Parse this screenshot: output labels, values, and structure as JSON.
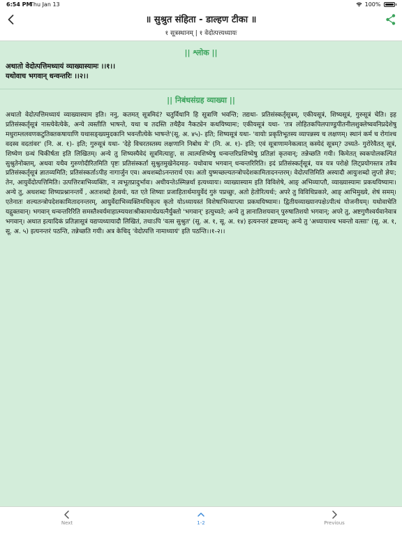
{
  "status_bar": {
    "time": "6:54 PM",
    "date": "Thu Jan 13",
    "battery": "100%"
  },
  "header": {
    "title": "॥ सुश्रुत संहिता - डाल्हण टीका ॥",
    "subtitle": "१ सूत्रस्थानम् | १ वेदोत्पत्त्यध्यायः"
  },
  "content": {
    "shloka_heading": "|| श्लोक ||",
    "shloka_lines": [
      "अथातो वेदोत्पत्तिमध्यायं व्याख्यास्यामः ।।१।।",
      "यथोवाच भगवान् धन्वन्तरिः ।।२।।"
    ],
    "vyakhya_heading": "|| निबंधसंग्रह व्याख्या ||",
    "vyakhya_text": "अथातो वेदोत्पत्तिमध्यायं व्याख्यास्याम इति। ननु, कतमत् सूत्रमिदं? चतुर्विधानि हि सूत्राणि भवन्ति; तद्यथा- प्रतिसंस्कर्तृसूत्रम्, एकीयसूत्रं, शिष्यसूत्रं, गुरुसूत्रं चेति। इह प्रतिसंस्कर्तृसूत्रं नास्त्येवेत्येके, अन्ये त्वस्तीति भाषन्ते, यथा च तदस्ति तथैहैव नैकट्येन कथयिष्यामः; एकीयसूत्रं यथा- 'तत्र लोहितकपिलपाण्डुपीतनीलशुक्लेष्ववनिप्रदेशेषु मधुराम्ललवणकटुतिक्तकषायाणि यथासङ्ख्यमुदकानि भवन्तीत्येके भाषन्ते'(सू. अ. ४५)- इति; शिष्यसूत्रं यथा- 'वायोः प्रकृतिभूतस्य व्यापन्नस्य च लक्षणम्। स्थानं कर्म च रोगांश्च वदस्व वदतांवर' (नि. अ. १)- इति; गुरुसूत्रं यथा- 'देहे विचरतस्तस्य लक्षणानि निबोध मे' (नि. अ. १)- इति; एवं सूत्राणामनेकत्वात् कस्येदं सूत्रम्? उच्यते- गुरोरेवैतत् सूत्रं, शिष्येण ग्रन्थं चिकीर्षता इति लिखितम्। अन्ये तु शिष्यस्यैवेदं सूत्रमित्याहुः, स त्वात्मशिष्येषु धन्वन्तरिप्रशिष्येषु प्रतिज्ञां कृतवान्; तन्नेच्छति गयी। किमेतत् स्वकपोलकल्पितं सुश्रुतेनोक्तम्, अथवा यथैव गुरुणोदीरितमिति पृष्टः प्रतिसंस्कर्ता सुश्रुतमुखेनेदमाह- यथोवाच भगवान् धन्वन्तरिरिति। इदं प्रतिसंस्कर्तृसूत्रं, यत्र यत्र परोक्षे लिट्प्रयोगस्तत्र तत्रैव प्रतिसंस्कर्तृसूत्रं ज्ञातव्यमिति; प्रतिसंस्कर्ताऽपीह नागार्जुन एव। अथशब्दोऽनन्तरार्थ एव। अतो युष्मच्छल्यतन्त्रोपदेशकामितादनन्तरम्। वेदोत्पत्तिमिति अस्यादौ आयुःशब्दो लुप्तो ज्ञेयः; तेन, आयुर्वेदोत्पत्तिमिति। उत्पत्तिरत्राभिव्यक्तिः, न त्वभूतप्रादुर्भावः। अधीयन्तेऽस्मिन्नर्था इत्यध्यायः। व्याख्यास्याम इति विविशेषे, आङ् अभिव्याप्तौ, व्याख्यास्यामः प्रकथयिष्यामः। अन्ये तु, अथशब्दः शिष्यप्रश्नानन्तर्ये , अतःशब्दो हेत्वर्थः, यत एते शिष्याः प्रजाहितार्थमायुर्वेदं गुरुं पप्रच्छुः, अतो हेतोरित्यर्थः; अपरे तु विविधिप्रकारे, आङ् आभिमुख्ये, शेषं समम्। एतेनातः शल्यतन्त्रोपदेशकामितादनन्तरम्, आयुर्वेदाभिव्यक्तिमधिकृत्य कृतो योऽध्यायस्तं विशेषाभिव्याप्त्या प्रकथयिष्यामः। द्वितीयव्याख्यानपक्षेऽपीत्थं योजनीयम्। यथोवाचेति यद्गुक्तवान्। भगवान् धन्वन्तरिरिति समस्तैश्वर्यमाहात्म्ययशःश्रीकामार्थप्रयत्नैर्युक्तो 'भगवान्' इत्युच्यते; अन्ये तु ज्ञानातिशयवान् पुरुषातिशयो भगवान्; अपरे तु, अष्टगुणैश्वर्यवानेवात्र भगवान्। अथात इत्यादिकं प्रतिज्ञासूत्रं यद्यप्यध्यायादौ लिखितं, तथाऽपि 'वत्स सुश्रुत' (सू. अ. १, सू. अ. १४) इत्यनन्तरं द्रष्टव्यम्; अन्ये तु 'अध्यायाश्च भवन्तो वत्साः' (सू. अ. १, सू. अ. ५) इत्यनन्तरं पठन्ति, तन्नेच्छति गयी। अत्र केचिद् 'वेदोत्पत्ति नामाध्यायं' इति पठन्ति।।१-२।।"
  },
  "bottom_nav": {
    "next_label": "Next",
    "page_label": "1-2",
    "previous_label": "Previous"
  },
  "colors": {
    "accent_green": "#3aa35b",
    "background": "#d3edda",
    "link_blue": "#3a88d8"
  }
}
